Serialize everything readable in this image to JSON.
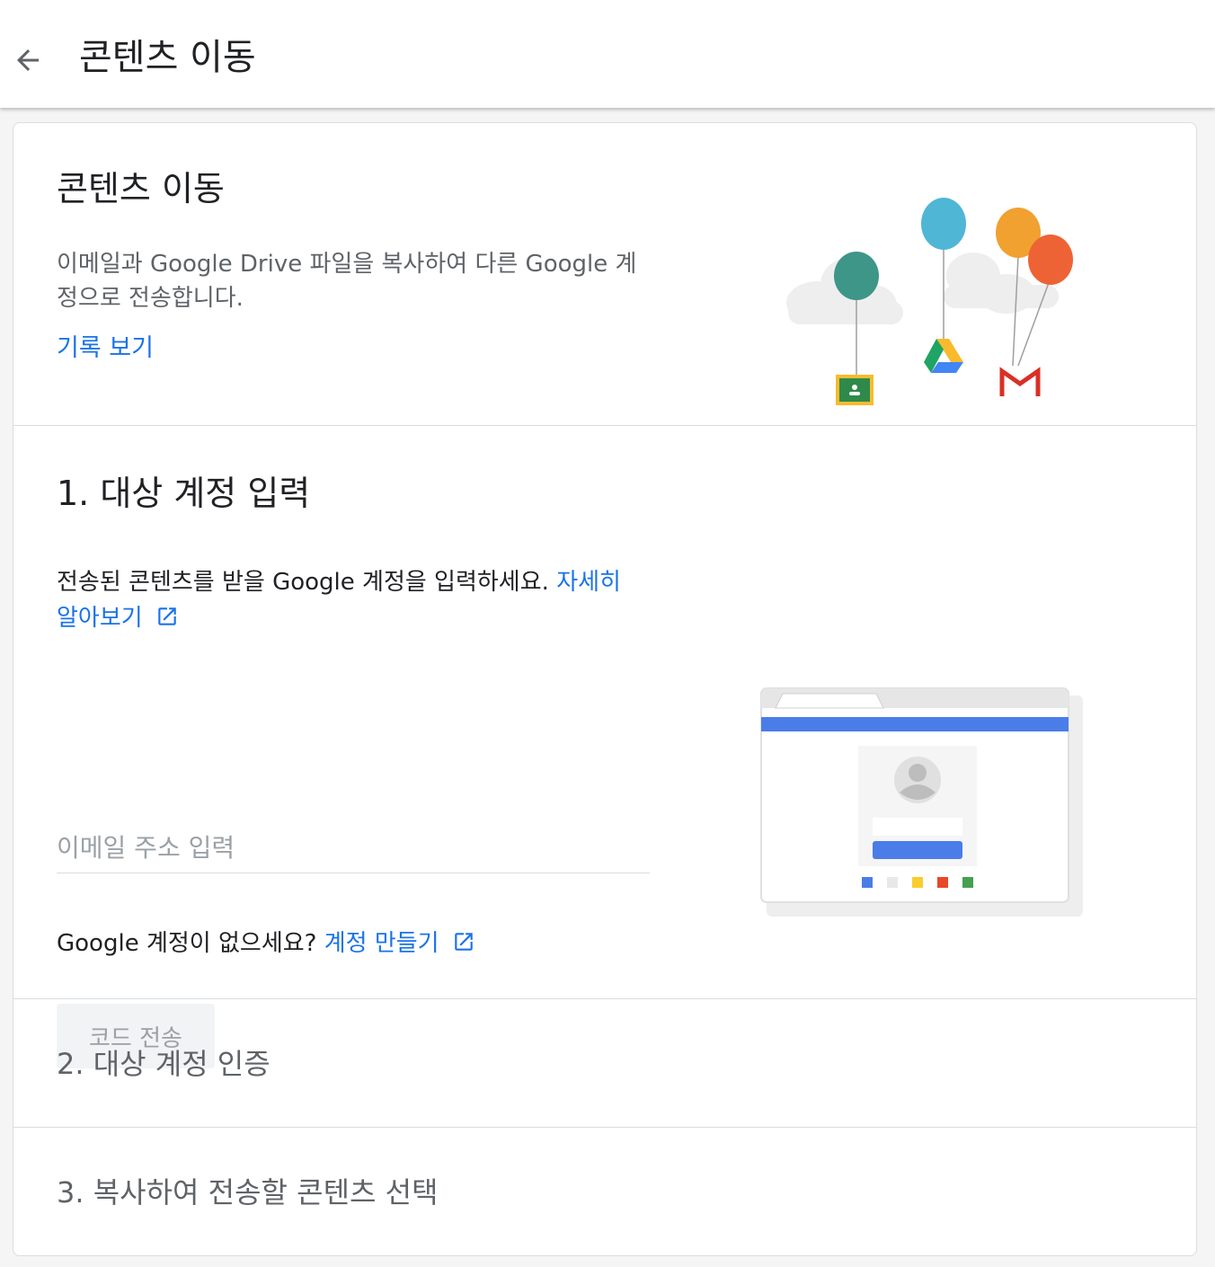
{
  "header": {
    "title": "콘텐츠 이동"
  },
  "intro": {
    "title": "콘텐츠 이동",
    "description": "이메일과 Google Drive 파일을 복사하여 다른 Google 계정으로 전송합니다.",
    "history_link": "기록 보기"
  },
  "step1": {
    "title": "1. 대상 계정 입력",
    "description": "전송된 콘텐츠를 받을 Google 계정을 입력하세요.",
    "learn_more_link": "자세히 알아보기",
    "email_placeholder": "이메일 주소 입력",
    "email_value": "",
    "no_account_text": "Google 계정이 없으세요?",
    "create_account_link": "계정 만들기",
    "send_code_button": "코드 전송"
  },
  "step2": {
    "title": "2. 대상 계정 인증"
  },
  "step3": {
    "title": "3. 복사하여 전송할 콘텐츠 선택"
  },
  "colors": {
    "link": "#1a73e8",
    "divider": "#dadce0",
    "balloon_teal": "#3d9688",
    "balloon_blue": "#4fb6d6",
    "balloon_orange": "#f0a130",
    "balloon_red": "#ee6335"
  }
}
